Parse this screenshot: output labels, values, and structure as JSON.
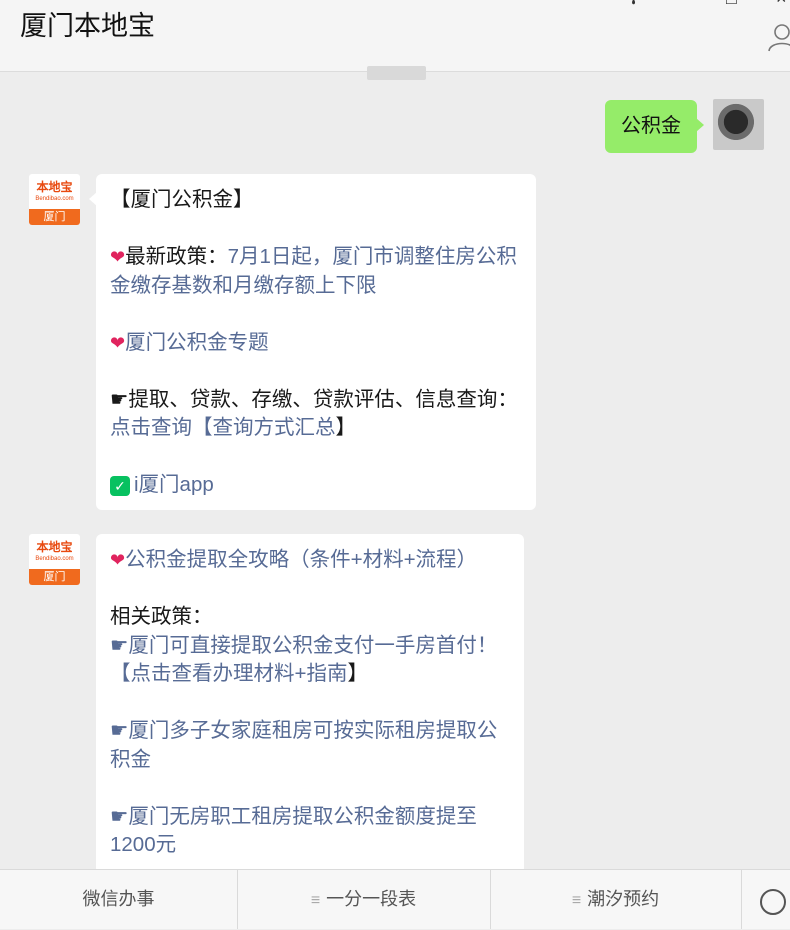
{
  "header": {
    "title": "厦门本地宝"
  },
  "chat": {
    "time": "",
    "user_message": "公积金",
    "bot_logo": {
      "brand": "本地宝",
      "domain": "Bendibao.com",
      "city": "厦门"
    },
    "message1": {
      "title": "【厦门公积金】",
      "policy_prefix": "最新政策：",
      "policy_link": "7月1日起，厦门市调整住房公积金缴存基数和月缴存额上下限",
      "topic_link": "厦门公积金专题",
      "services_prefix": "☛提取、贷款、存缴、贷款评估、信息查询：",
      "services_link1": "点击查询",
      "services_link2": "【查询方式汇总",
      "services_suffix": "】",
      "app_link": "i厦门app"
    },
    "message2": {
      "guide_link": "公积金提取全攻略（条件+材料+流程）",
      "related_label": "相关政策：",
      "item1_link": "☛厦门可直接提取公积金支付一手房首付！",
      "item1_sub_link": "【点击查看办理材料+指南",
      "item1_sub_suffix": "】",
      "item2_link": "☛厦门多子女家庭租房可按实际租房提取公积金",
      "item3_link": "☛厦门无房职工租房提取公积金额度提至1200元"
    }
  },
  "menu": {
    "items": [
      {
        "label": "微信办事"
      },
      {
        "label": "一分一段表"
      },
      {
        "label": "潮汐预约"
      }
    ]
  }
}
